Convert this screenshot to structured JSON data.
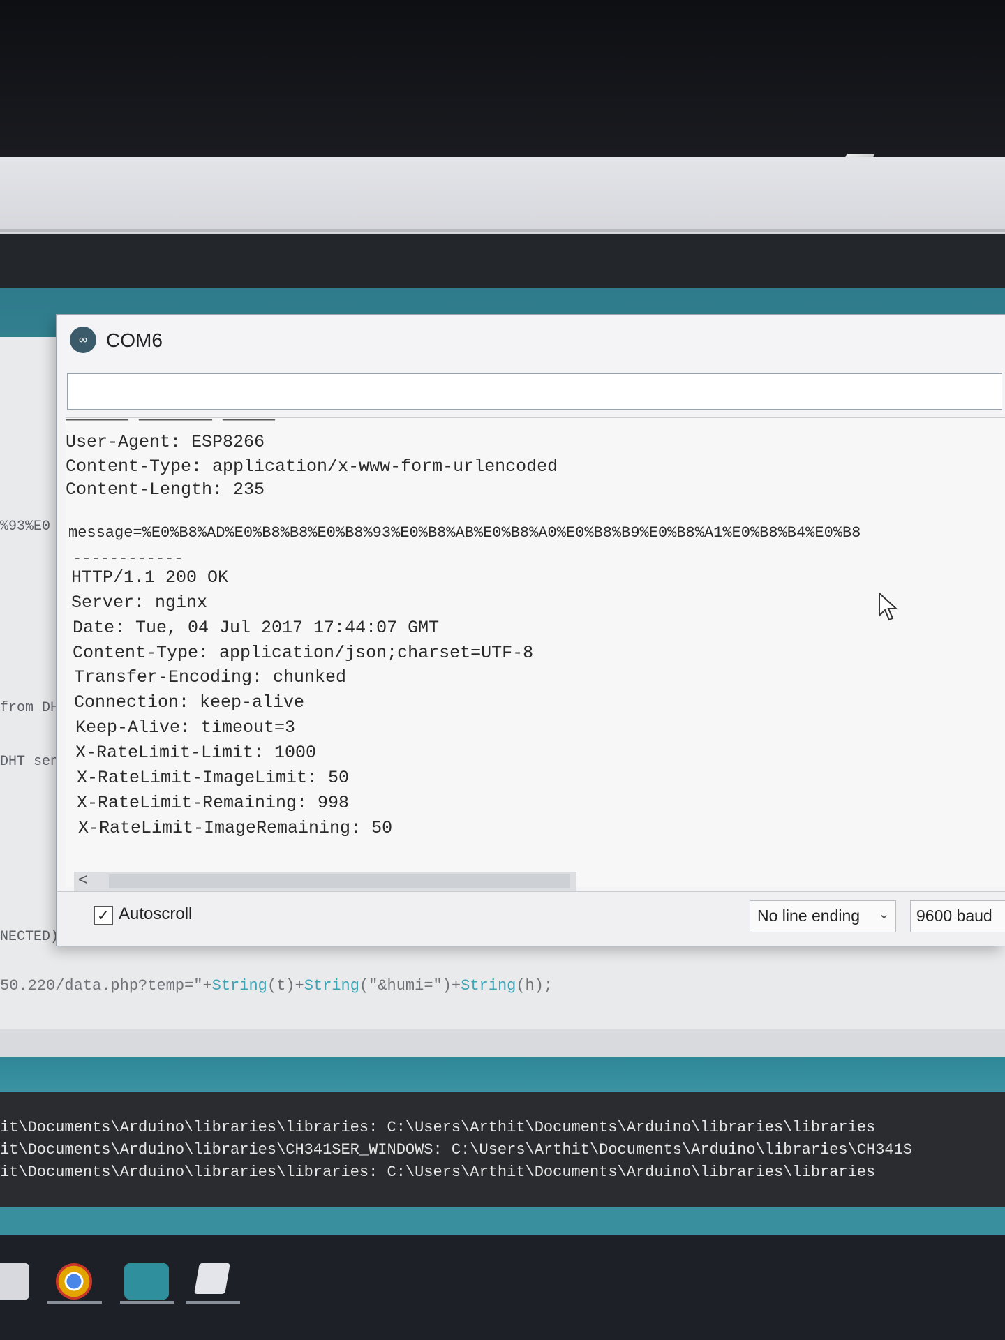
{
  "serial_monitor": {
    "title": "COM6",
    "logo_glyph": "∞",
    "send_input": {
      "value": "",
      "placeholder": ""
    },
    "output_lines": [
      "User-Agent: ESP8266",
      "Content-Type: application/x-www-form-urlencoded",
      "Content-Length: 235",
      "",
      "message=%E0%B8%AD%E0%B8%B8%E0%B8%93%E0%B8%AB%E0%B8%A0%E0%B8%B9%E0%B8%A1%E0%B8%B4%E0%B8",
      "HTTP/1.1 200 OK",
      "Server: nginx",
      "Date: Tue, 04 Jul 2017 17:44:07 GMT",
      "Content-Type: application/json;charset=UTF-8",
      "Transfer-Encoding: chunked",
      "Connection: keep-alive",
      "Keep-Alive: timeout=3",
      "X-RateLimit-Limit: 1000",
      "X-RateLimit-ImageLimit: 50",
      "X-RateLimit-Remaining: 998",
      "X-RateLimit-ImageRemaining: 50"
    ],
    "separator": "------------",
    "scroll_left_glyph": "<",
    "autoscroll": {
      "label": "Autoscroll",
      "checked": true,
      "check_glyph": "✓"
    },
    "line_ending": {
      "selected": "No line ending",
      "chevron": "⌄"
    },
    "baud": {
      "selected": "9600 baud"
    }
  },
  "editor": {
    "fragments": [
      "%93%E0",
      "from DHT",
      "DHT sen",
      "NECTED))"
    ],
    "code_line": {
      "part1": "50.220/data.php?temp=\"+",
      "kw1": "String",
      "part2": "(t)+",
      "kw2": "String",
      "part3": "(\"&humi=\")+",
      "kw3": "String",
      "part4": "(h);"
    }
  },
  "console": {
    "lines": [
      "it\\Documents\\Arduino\\libraries\\libraries: C:\\Users\\Arthit\\Documents\\Arduino\\libraries\\libraries",
      "it\\Documents\\Arduino\\libraries\\CH341SER_WINDOWS: C:\\Users\\Arthit\\Documents\\Arduino\\libraries\\CH341S",
      "it\\Documents\\Arduino\\libraries\\libraries: C:\\Users\\Arthit\\Documents\\Arduino\\libraries\\libraries"
    ]
  },
  "taskbar": {
    "icons": [
      "store-icon",
      "chrome-icon",
      "arduino-icon",
      "notes-icon"
    ]
  },
  "colors": {
    "teal": "#327f90",
    "console_bg": "#2a2c30",
    "keyword": "#3ea3b5"
  }
}
